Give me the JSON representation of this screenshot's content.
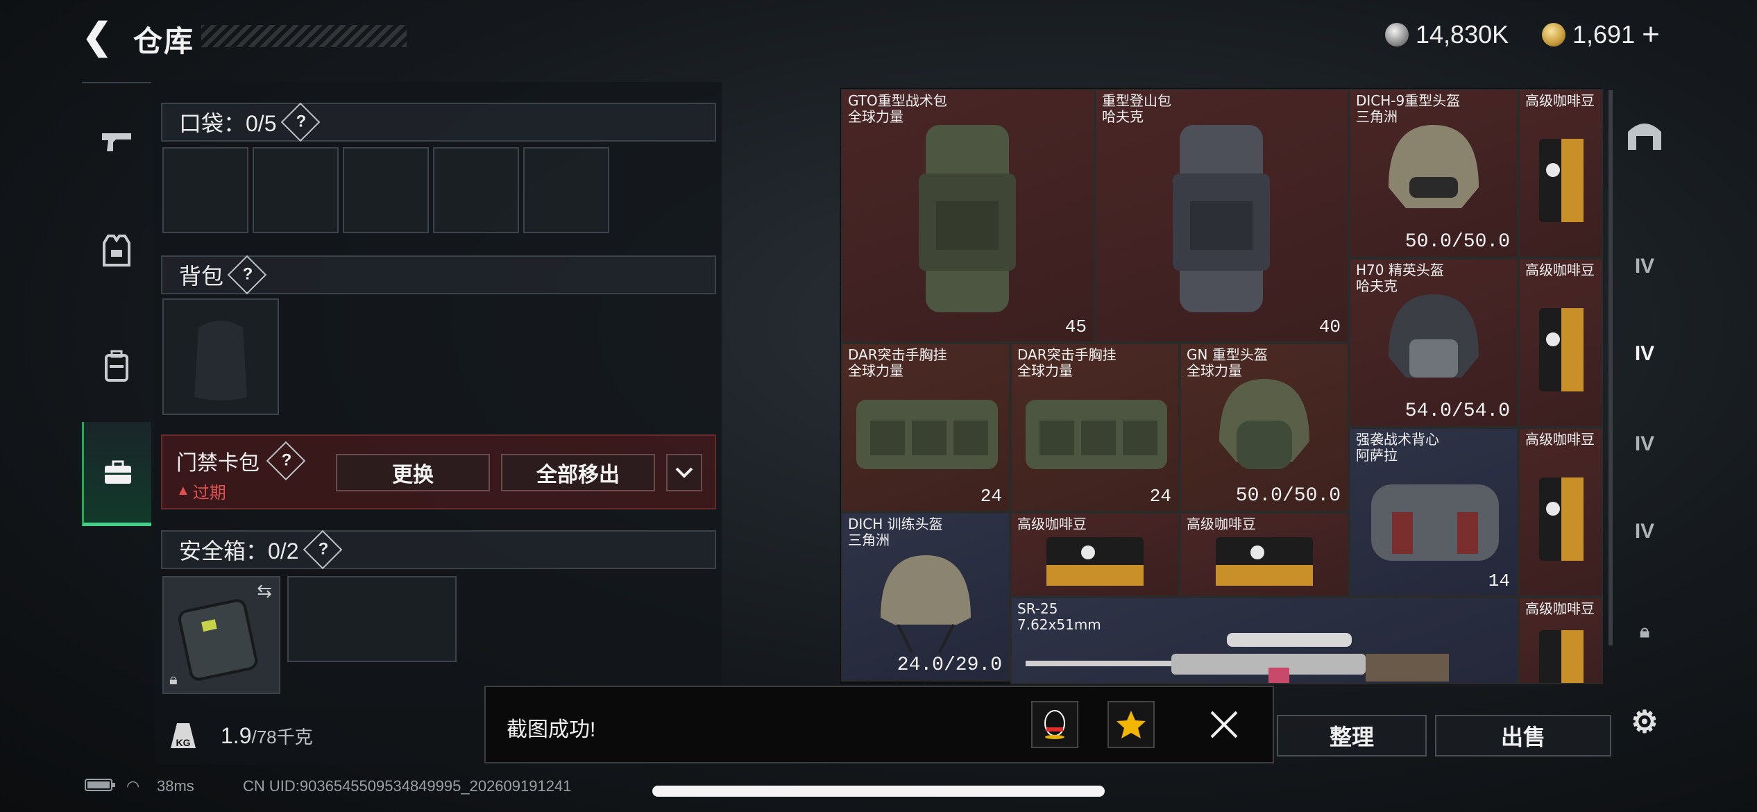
{
  "header": {
    "back_icon": "chevron-left-icon",
    "title": "仓库",
    "currency": [
      {
        "icon": "silver-coin-icon",
        "value": "14,830K"
      },
      {
        "icon": "gold-coin-icon",
        "value": "1,691"
      }
    ],
    "add_label": "+"
  },
  "left_nav": [
    "pistol-icon",
    "armor-vest-icon",
    "backpack-icon",
    "briefcase-icon"
  ],
  "pockets": {
    "label": "口袋：0/5",
    "help": "?",
    "slots": 5
  },
  "backpack": {
    "label": "背包",
    "help": "?"
  },
  "keycard": {
    "label": "门禁卡包",
    "help": "?",
    "warning": "过期",
    "replace_label": "更换",
    "remove_all_label": "全部移出",
    "dropdown_icon": "chevron-down-icon"
  },
  "safebox": {
    "label": "安全箱：0/2",
    "help": "?"
  },
  "weight": {
    "current": "1.9",
    "max": "/78千克",
    "icon_text": "KG"
  },
  "grid_items": [
    {
      "name": "GTO重型战术包\n全球力量",
      "count": "45",
      "tint": "red"
    },
    {
      "name": "重型登山包\n哈夫克",
      "count": "40",
      "tint": "red"
    },
    {
      "name": "DICH-9重型头盔\n三角洲",
      "count": "50.0/50.0",
      "tint": "red"
    },
    {
      "name": "高级咖啡豆",
      "count": "",
      "tint": "red"
    },
    {
      "name": "H70 精英头盔\n哈夫克",
      "count": "54.0/54.0",
      "tint": "red"
    },
    {
      "name": "高级咖啡豆",
      "count": "",
      "tint": "red"
    },
    {
      "name": "DAR突击手胸挂\n全球力量",
      "count": "24",
      "tint": "gold"
    },
    {
      "name": "DAR突击手胸挂\n全球力量",
      "count": "24",
      "tint": "gold"
    },
    {
      "name": "GN 重型头盔\n全球力量",
      "count": "50.0/50.0",
      "tint": "gold"
    },
    {
      "name": "强袭战术背心\n阿萨拉",
      "count": "14",
      "tint": "blue"
    },
    {
      "name": "高级咖啡豆",
      "count": "",
      "tint": "red"
    },
    {
      "name": "DICH 训练头盔\n三角洲",
      "count": "24.0/29.0",
      "tint": "blue"
    },
    {
      "name": "高级咖啡豆",
      "count": "",
      "tint": "red"
    },
    {
      "name": "高级咖啡豆",
      "count": "",
      "tint": "red"
    },
    {
      "name": "SR-25\n7.62x51mm",
      "count": "",
      "tint": "blue"
    },
    {
      "name": "高级咖啡豆",
      "count": "",
      "tint": "red"
    }
  ],
  "right_nav": [
    {
      "icon": "all-storage-icon",
      "label": ""
    },
    {
      "icon": "storage-tab-icon",
      "label": ""
    },
    {
      "icon": "storage-tab-icon",
      "label": "IV"
    },
    {
      "icon": "storage-tab-icon",
      "label": "IV"
    },
    {
      "icon": "storage-tab-icon",
      "label": "IV"
    },
    {
      "icon": "storage-tab-icon",
      "label": "IV"
    },
    {
      "icon": "lock-icon",
      "label": ""
    },
    {
      "icon": "gear-icon",
      "label": ""
    }
  ],
  "actions": {
    "sort_label": "整理",
    "sell_label": "出售"
  },
  "toast": {
    "message": "截图成功!",
    "close_icon": "close-icon",
    "share_icons": [
      "qq-icon",
      "qzone-icon"
    ]
  },
  "status_bar": {
    "ping": "38ms",
    "uid": "CN UID:9036545509534849995_202609191241"
  }
}
